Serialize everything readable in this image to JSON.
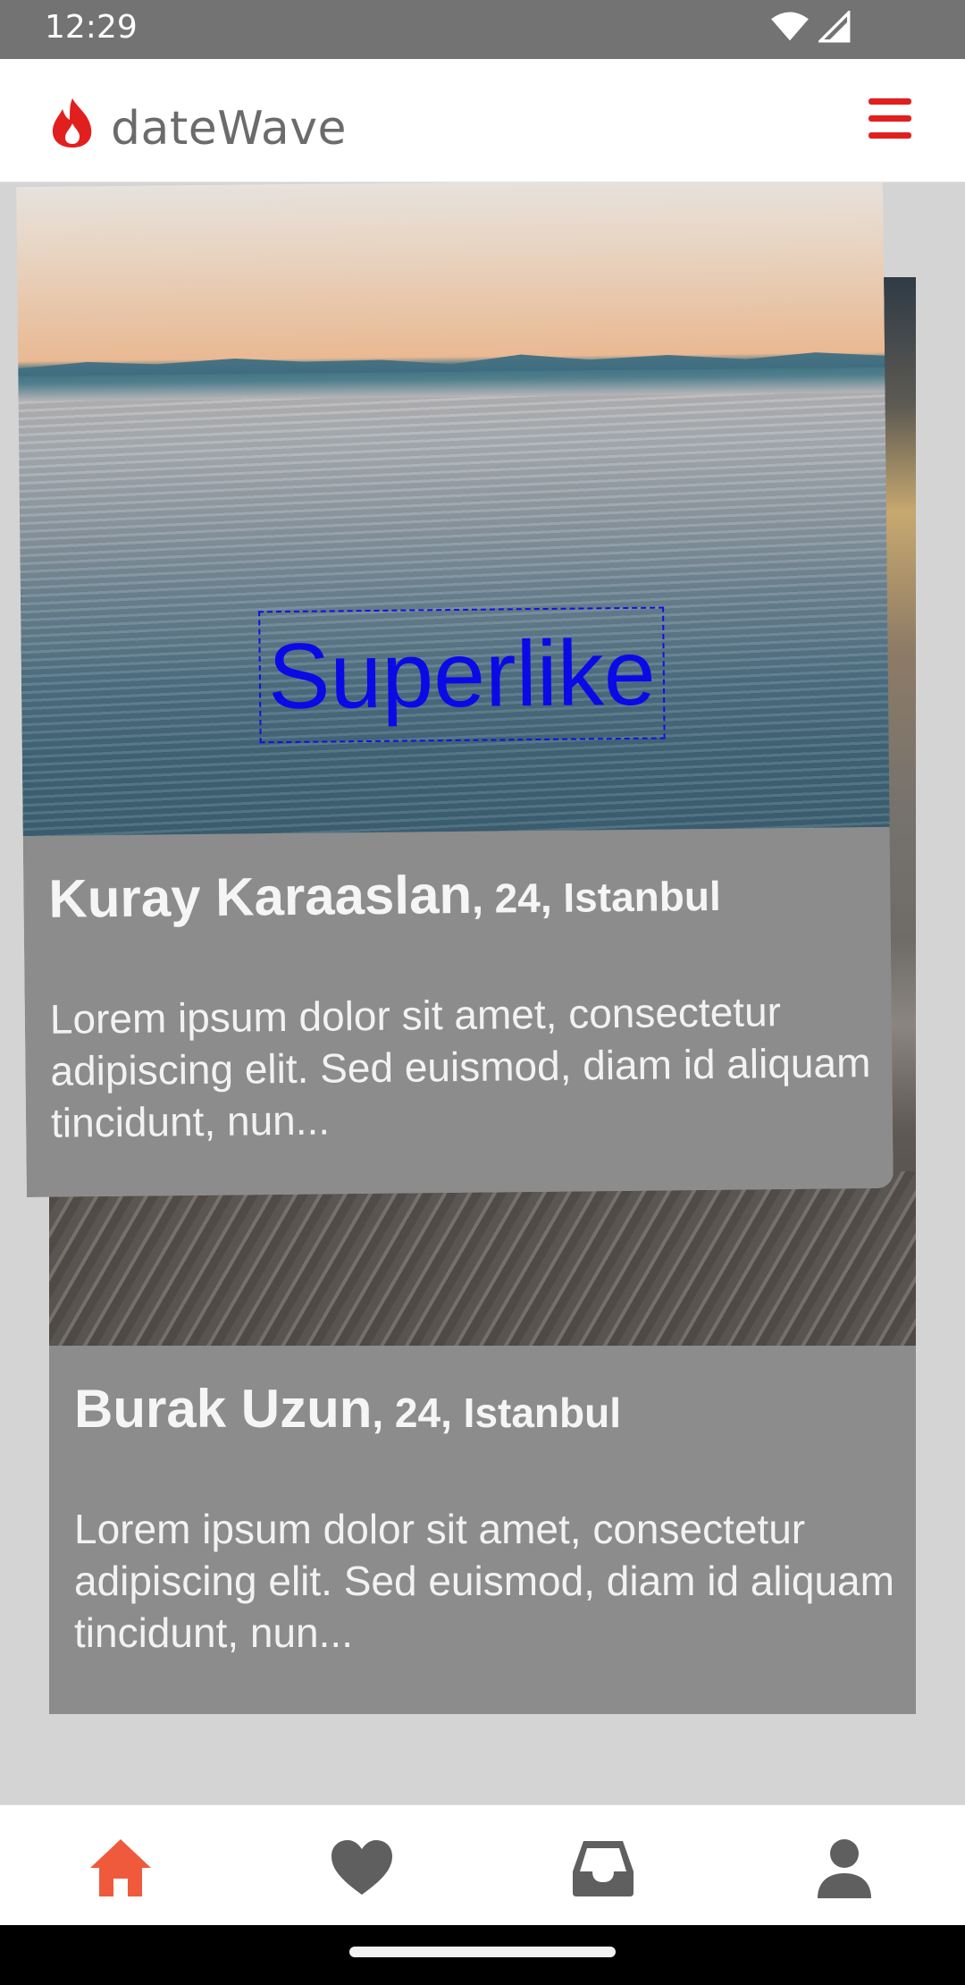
{
  "status_bar": {
    "time": "12:29",
    "icons": [
      "wifi-icon",
      "signal-icon"
    ]
  },
  "header": {
    "app_title": "dateWave",
    "logo_icon": "flame-icon",
    "menu_icon": "hamburger-menu-icon"
  },
  "colors": {
    "brand": "#e21f1f",
    "nav_active": "#f05a3c",
    "nav_inactive": "#5f5f5f",
    "info_panel": "#8c8c8c",
    "superlike": "#0a0ae6"
  },
  "cards": {
    "front": {
      "name": "Kuray Karaaslan",
      "meta": ", 24, Istanbul",
      "bio": "Lorem ipsum dolor sit amet, consectetur adipiscing elit. Sed euismod, diam id aliquam tincidunt, nun...",
      "swipe_label": "Superlike"
    },
    "back": {
      "name": "Burak Uzun",
      "meta": ", 24, Istanbul",
      "bio": "Lorem ipsum dolor sit amet, consectetur adipiscing elit. Sed euismod, diam id aliquam tincidunt, nun..."
    }
  },
  "bottom_nav": {
    "items": [
      {
        "icon": "home-icon",
        "active": true
      },
      {
        "icon": "heart-icon",
        "active": false
      },
      {
        "icon": "inbox-icon",
        "active": false
      },
      {
        "icon": "profile-icon",
        "active": false
      }
    ]
  }
}
